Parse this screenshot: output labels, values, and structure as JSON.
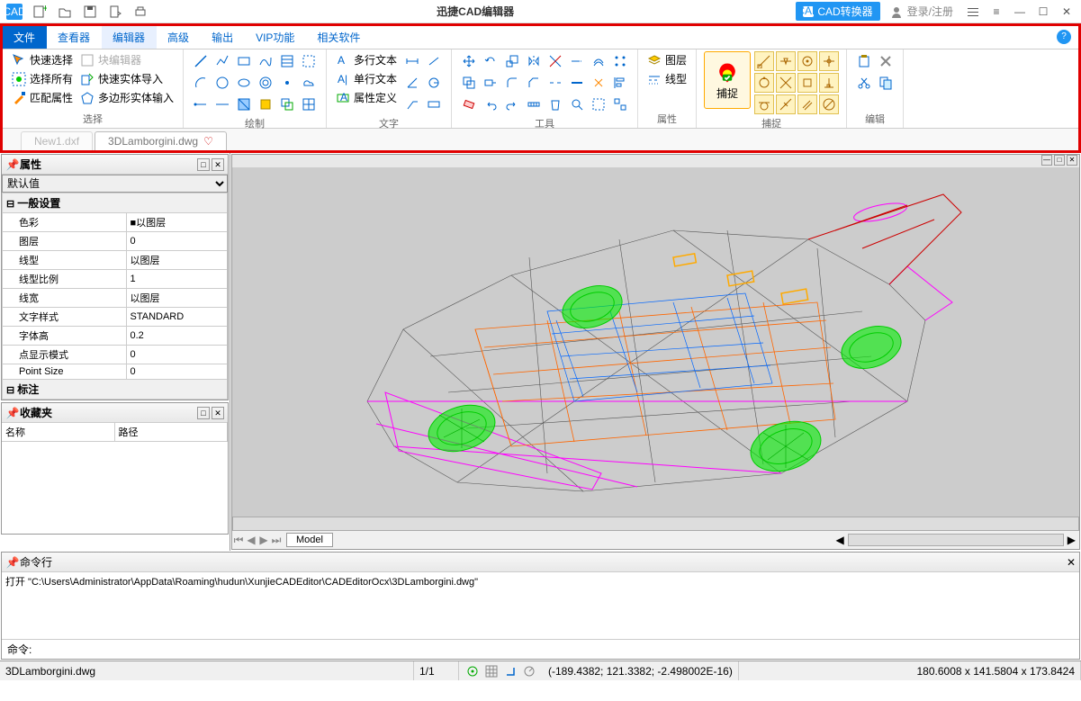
{
  "app": {
    "title": "迅捷CAD编辑器",
    "cad_converter": "CAD转换器",
    "login": "登录/注册"
  },
  "tabs": {
    "file": "文件",
    "viewer": "查看器",
    "editor": "编辑器",
    "advanced": "高级",
    "output": "输出",
    "vip": "VIP功能",
    "related": "相关软件"
  },
  "ribbon": {
    "select": {
      "label": "选择",
      "quick_select": "快速选择",
      "select_all": "选择所有",
      "match_props": "匹配属性",
      "block_editor": "块编辑器",
      "quick_import": "快速实体导入",
      "polygon_input": "多边形实体输入"
    },
    "draw": {
      "label": "绘制"
    },
    "text": {
      "label": "文字",
      "mtext": "多行文本",
      "stext": "单行文本",
      "attr_def": "属性定义"
    },
    "tools": {
      "label": "工具"
    },
    "props": {
      "label": "属性",
      "layer": "图层",
      "linetype": "线型"
    },
    "capture": {
      "label": "捕捉",
      "btn": "捕捉"
    },
    "edit": {
      "label": "编辑"
    }
  },
  "filetabs": {
    "t1": "New1.dxf",
    "t2": "3DLamborgini.dwg"
  },
  "panels": {
    "properties": {
      "title": "属性",
      "default": "默认值",
      "general": "一般设置",
      "rows": {
        "color_k": "色彩",
        "color_v": "■以图层",
        "layer_k": "图层",
        "layer_v": "0",
        "ltype_k": "线型",
        "ltype_v": "以图层",
        "lscale_k": "线型比例",
        "lscale_v": "1",
        "lweight_k": "线宽",
        "lweight_v": "以图层",
        "tstyle_k": "文字样式",
        "tstyle_v": "STANDARD",
        "theight_k": "字体高",
        "theight_v": "0.2",
        "pmode_k": "点显示模式",
        "pmode_v": "0",
        "psize_k": "Point Size",
        "psize_v": "0"
      },
      "dim": "标注"
    },
    "favorites": {
      "title": "收藏夹",
      "name": "名称",
      "path": "路径"
    },
    "cmdline": {
      "title": "命令行",
      "log": "打开 \"C:\\Users\\Administrator\\AppData\\Roaming\\hudun\\XunjieCADEditor\\CADEditorOcx\\3DLamborgini.dwg\"",
      "prompt": "命令:"
    }
  },
  "viewport": {
    "model_tab": "Model"
  },
  "status": {
    "file": "3DLamborgini.dwg",
    "pages": "1/1",
    "coords": "(-189.4382; 121.3382; -2.498002E-16)",
    "dims": "180.6008 x 141.5804 x 173.8424"
  }
}
